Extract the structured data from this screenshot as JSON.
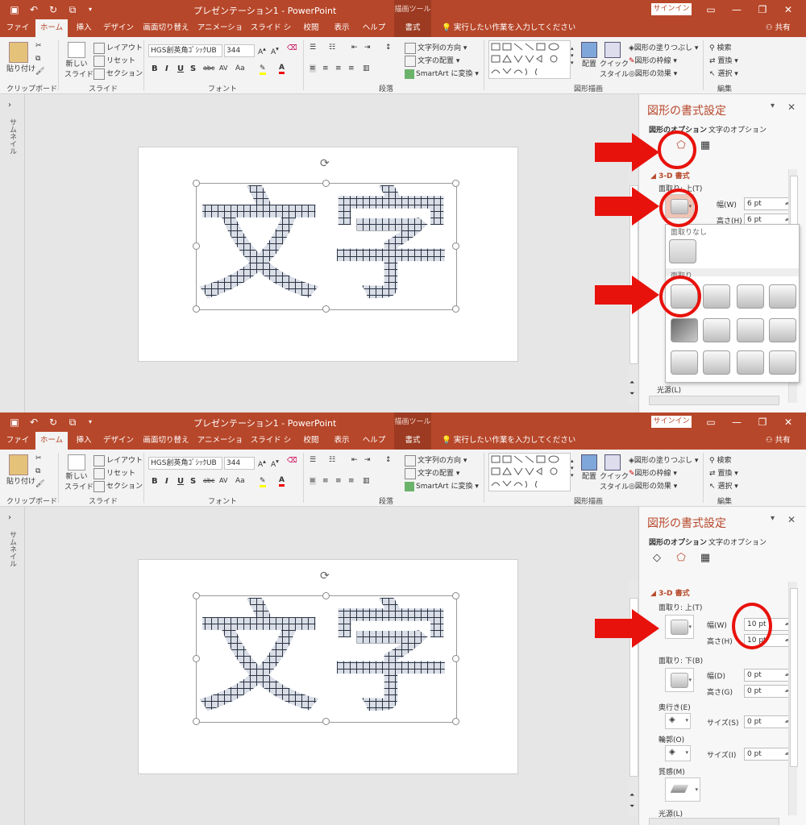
{
  "titlebar": {
    "doc_title": "プレゼンテーション1  -  PowerPoint",
    "context_tab": "描画ツール",
    "signin": "サインイン"
  },
  "tabs": [
    "ファイル",
    "ホーム",
    "挿入",
    "デザイン",
    "画面切り替え",
    "アニメーション",
    "スライド ショー",
    "校閲",
    "表示",
    "ヘルプ",
    "書式"
  ],
  "tell_me": "実行したい作業を入力してください",
  "share": "共有",
  "ribbon": {
    "clipboard": {
      "paste": "貼り付け",
      "label": "クリップボード"
    },
    "slides": {
      "new_slide_1": "新しい",
      "new_slide_2": "スライド",
      "layout": "レイアウト",
      "reset": "リセット",
      "section": "セクション",
      "label": "スライド"
    },
    "font": {
      "name": "HGS創英角ｺﾞｼｯｸUB",
      "size": "344",
      "bold": "B",
      "italic": "I",
      "underline": "U",
      "shadow": "S",
      "strike": "abc",
      "spacing": "AV",
      "case": "Aa",
      "label": "フォント"
    },
    "paragraph": {
      "direction": "文字列の方向",
      "align": "文字の配置",
      "smartart": "SmartArt に変換",
      "label": "段落"
    },
    "drawing": {
      "arrange": "配置",
      "quick_1": "クイック",
      "quick_2": "スタイル",
      "fill": "図形の塗りつぶし",
      "outline": "図形の枠線",
      "effects": "図形の効果",
      "label": "図形描画"
    },
    "editing": {
      "find": "検索",
      "replace": "置換",
      "select": "選択",
      "label": "編集"
    }
  },
  "thumb_pane": "サムネイル",
  "slide_text": [
    "文",
    "字"
  ],
  "pane": {
    "title": "図形の書式設定",
    "tab_shape": "図形のオプション",
    "tab_text": "文字のオプション",
    "section": "3-D 書式",
    "bevel_top": "面取り: 上(T)",
    "bevel_bottom": "面取り: 下(B)",
    "width": "幅(W)",
    "height": "高さ(H)",
    "width_d": "幅(D)",
    "height_g": "高さ(G)",
    "depth": "奥行き(E)",
    "contour": "輪郭(O)",
    "size_s": "サイズ(S)",
    "size_i": "サイズ(I)",
    "material": "質感(M)",
    "lighting": "光源(L)"
  },
  "top_state": {
    "top_width": "6 pt",
    "top_height": "6 pt",
    "gallery_none": "面取りなし",
    "gallery_bevel": "面取り"
  },
  "bottom_state": {
    "top_width": "10 pt",
    "top_height": "10 pt",
    "bottom_width": "0 pt",
    "bottom_height": "0 pt",
    "depth_size": "0 pt",
    "contour_size": "0 pt"
  },
  "colors": {
    "accent": "#b7472a",
    "highlight": "#e8120c",
    "ribbon": "#f3f3f3"
  }
}
